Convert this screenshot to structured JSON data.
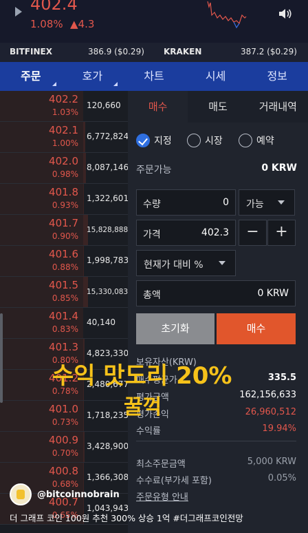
{
  "ticker": {
    "price": "402.4",
    "change_pct": "1.08%",
    "change_amt": "▲4.3",
    "play_icon": "play-icon",
    "volume_icon": "volume-icon"
  },
  "exchanges": [
    {
      "name": "BITFINEX",
      "price": "386.9 ($0.29)"
    },
    {
      "name": "KRAKEN",
      "price": "387.2 ($0.29)"
    }
  ],
  "tabs": [
    {
      "label": "주문",
      "active": true,
      "has_triangle": true
    },
    {
      "label": "호가",
      "active": false,
      "has_triangle": true
    },
    {
      "label": "차트",
      "active": false,
      "has_triangle": false
    },
    {
      "label": "시세",
      "active": false,
      "has_triangle": false
    },
    {
      "label": "정보",
      "active": false,
      "has_triangle": false
    }
  ],
  "orderbook": [
    {
      "price": "402.2",
      "change": "1.03%",
      "volume": "120,660",
      "small": false,
      "bar": 0
    },
    {
      "price": "402.1",
      "change": "1.00%",
      "volume": "6,772,824",
      "small": false,
      "bar": 0.05
    },
    {
      "price": "402.0",
      "change": "0.98%",
      "volume": "8,087,146",
      "small": false,
      "bar": 0.06
    },
    {
      "price": "401.8",
      "change": "0.93%",
      "volume": "1,322,601",
      "small": false,
      "bar": 0.01
    },
    {
      "price": "401.7",
      "change": "0.90%",
      "volume": "15,828,888",
      "small": true,
      "bar": 0.1
    },
    {
      "price": "401.6",
      "change": "0.88%",
      "volume": "1,998,783",
      "small": false,
      "bar": 0.02
    },
    {
      "price": "401.5",
      "change": "0.85%",
      "volume": "15,330,083",
      "small": true,
      "bar": 0.1
    },
    {
      "price": "401.4",
      "change": "0.83%",
      "volume": "40,140",
      "small": false,
      "bar": 0
    },
    {
      "price": "401.3",
      "change": "0.80%",
      "volume": "4,823,330",
      "small": false,
      "bar": 0.03
    },
    {
      "price": "401.2",
      "change": "0.78%",
      "volume": "2,480,677",
      "small": false,
      "bar": 0.02
    },
    {
      "price": "401.0",
      "change": "0.73%",
      "volume": "1,718,235",
      "small": false,
      "bar": 0.01
    },
    {
      "price": "400.9",
      "change": "0.70%",
      "volume": "3,428,900",
      "small": false,
      "bar": 0.03
    },
    {
      "price": "400.8",
      "change": "0.68%",
      "volume": "1,366,308",
      "small": false,
      "bar": 0.01
    },
    {
      "price": "400.7",
      "change": "0.65%",
      "volume": "1,043,943",
      "small": false,
      "bar": 0.01
    }
  ],
  "order_tabs": {
    "buy": "매수",
    "sell": "매도",
    "history": "거래내역"
  },
  "radios": {
    "limit": "지정",
    "market": "시장",
    "reserve": "예약"
  },
  "available": {
    "label": "주문가능",
    "value": "0 KRW"
  },
  "quantity": {
    "label": "수량",
    "value": "0",
    "dropdown": "가능"
  },
  "price_field": {
    "label": "가격",
    "value": "402.3",
    "minus": "−",
    "plus": "+"
  },
  "price_dropdown": "현재가 대비 %",
  "amount": {
    "label": "총액",
    "value": "0 KRW"
  },
  "buttons": {
    "reset": "초기화",
    "buy": "매수"
  },
  "holdings": {
    "title": "보유자산(KRW)",
    "avg_label": "매수평균가",
    "avg_value": "335.5",
    "eval_label": "평가금액",
    "eval_value": "162,156,633",
    "profit_label": "평가손익",
    "profit_value": "26,960,512",
    "rate_label": "수익률",
    "rate_value": "19.94%"
  },
  "limits": {
    "min_label": "최소주문금액",
    "min_value": "5,000 KRW",
    "fee_label": "수수료(부가세 포함)",
    "fee_value": "0.05%",
    "guide": "주문유형 안내"
  },
  "overlay": {
    "line1": "수익 맛도리 20%",
    "line2": "꿀꺽",
    "channel": "@bitcoinnobrain",
    "description": "더 그래프 코인 100원 추천 300% 상승 1억 #더그래프코인전망"
  },
  "colors": {
    "up": "#e2574c",
    "accent": "#1b3d9e",
    "buy": "#e1562c",
    "caption": "#f6c21a"
  }
}
